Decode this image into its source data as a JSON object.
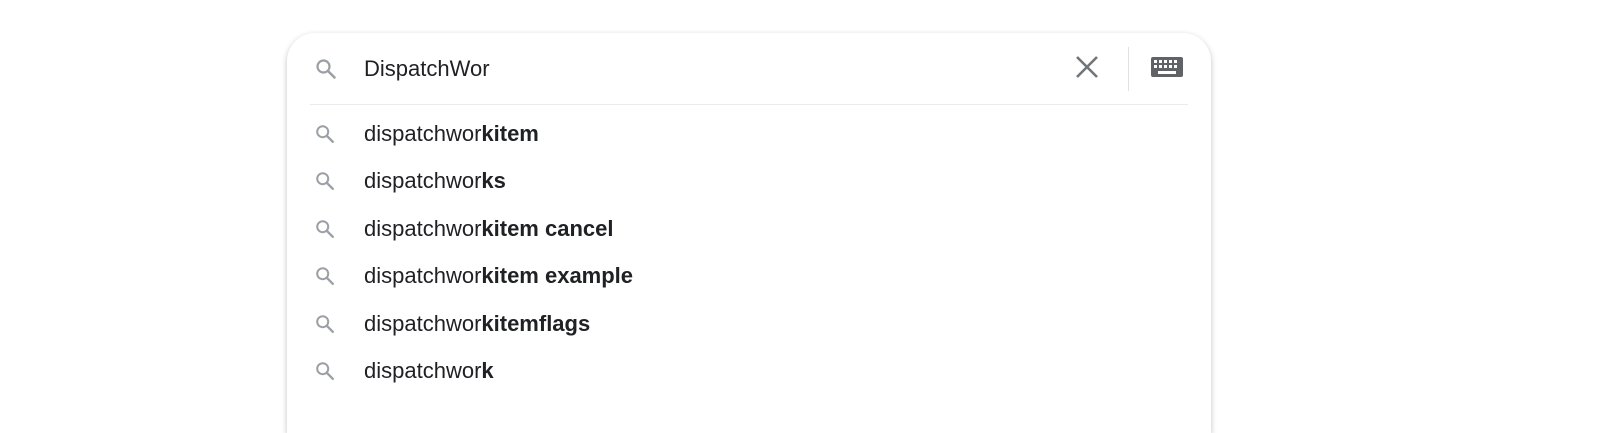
{
  "search": {
    "value": "DispatchWor",
    "clear_icon": "close-icon",
    "keyboard_icon": "keyboard-icon",
    "search_icon": "search-icon"
  },
  "suggestions": [
    {
      "prefix": "dispatchwor",
      "completion": "kitem"
    },
    {
      "prefix": "dispatchwor",
      "completion": "ks"
    },
    {
      "prefix": "dispatchwor",
      "completion": "kitem cancel"
    },
    {
      "prefix": "dispatchwor",
      "completion": "kitem example"
    },
    {
      "prefix": "dispatchwor",
      "completion": "kitemflags"
    },
    {
      "prefix": "dispatchwor",
      "completion": "k"
    }
  ],
  "colors": {
    "icon_gray": "#9aa0a6",
    "text": "#202124",
    "clear_gray": "#70757a",
    "divider": "#dfe1e5"
  }
}
